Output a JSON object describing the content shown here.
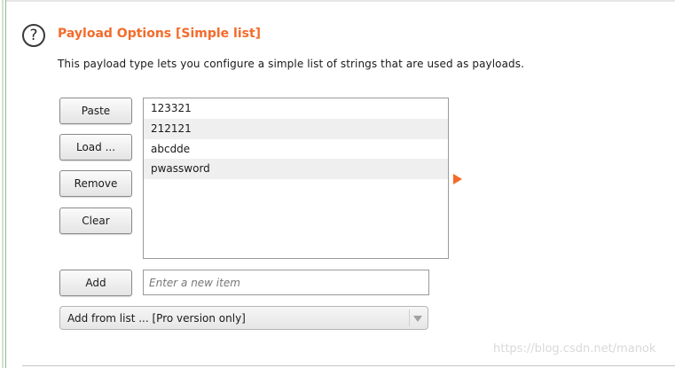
{
  "section": {
    "title": "Payload Options [Simple list]",
    "description": "This payload type lets you configure a simple list of strings that are used as payloads.",
    "help_icon": "question-circle-icon"
  },
  "buttons": {
    "paste": "Paste",
    "load": "Load ...",
    "remove": "Remove",
    "clear": "Clear",
    "add": "Add"
  },
  "payload_list": {
    "items": [
      "123321",
      "212121",
      "abcdde",
      "pwassword"
    ]
  },
  "add_input": {
    "value": "",
    "placeholder": "Enter a new item"
  },
  "add_from_list": {
    "selected": "Add from list ... [Pro version only]"
  },
  "watermark": "https://blog.csdn.net/manok",
  "colors": {
    "accent": "#f36b2b"
  }
}
